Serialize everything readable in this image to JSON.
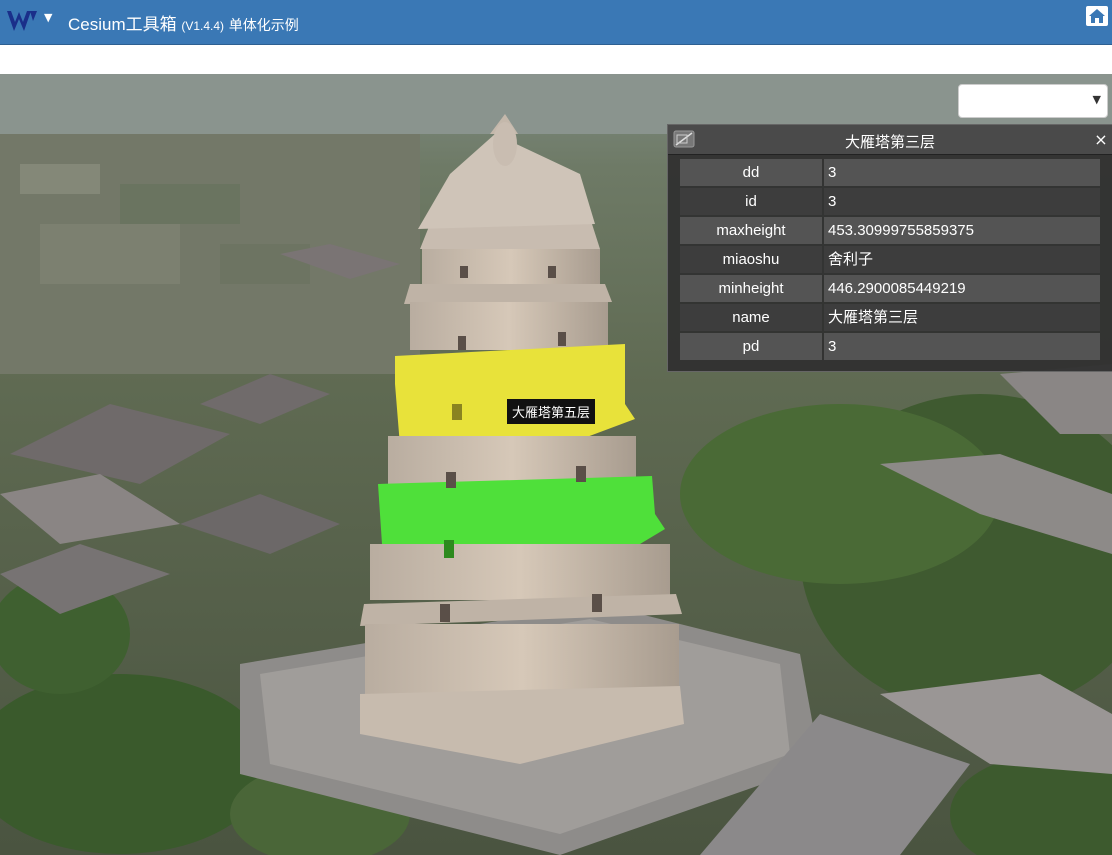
{
  "app": {
    "title": "Cesium工具箱",
    "version": "(V1.4.4)",
    "subtitle": "单体化示例",
    "logo_icon": "w-logo-icon",
    "home_icon": "home-icon",
    "accent": "#3a78b5"
  },
  "scene": {
    "hover_label": "大雁塔第五层",
    "highlight_yellow": "#e8e23a",
    "highlight_green": "#4fe03a"
  },
  "layer_select": {
    "selected": ""
  },
  "info_panel": {
    "title": "大雁塔第三层",
    "close_label": "×",
    "camera_icon": "camera-off-icon",
    "rows": [
      {
        "key": "dd",
        "value": "3"
      },
      {
        "key": "id",
        "value": "3"
      },
      {
        "key": "maxheight",
        "value": "453.30999755859375"
      },
      {
        "key": "miaoshu",
        "value": "舍利子"
      },
      {
        "key": "minheight",
        "value": "446.2900085449219"
      },
      {
        "key": "name",
        "value": "大雁塔第三层"
      },
      {
        "key": "pd",
        "value": "3"
      }
    ]
  }
}
